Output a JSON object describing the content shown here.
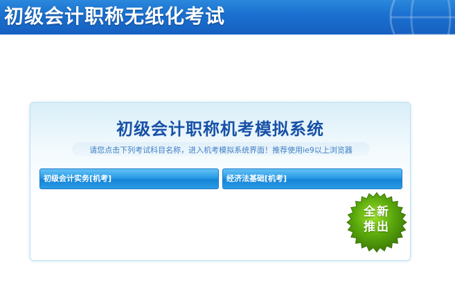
{
  "header": {
    "title": "初级会计职称无纸化考试"
  },
  "panel": {
    "title": "初级会计职称机考模拟系统",
    "hint": "请您点击下列考试科目名称，进入机考模拟系统界面！推荐使用ie9以上浏览器"
  },
  "exams": [
    {
      "label": "初级会计实务[机考]"
    },
    {
      "label": "经济法基础[机考]"
    }
  ],
  "badge": {
    "line1": "全新",
    "line2": "推出"
  },
  "colors": {
    "header_blue": "#1a6fcf",
    "title_blue": "#1750a6",
    "button_blue": "#2a9ae6",
    "badge_green": "#5aa80c"
  }
}
